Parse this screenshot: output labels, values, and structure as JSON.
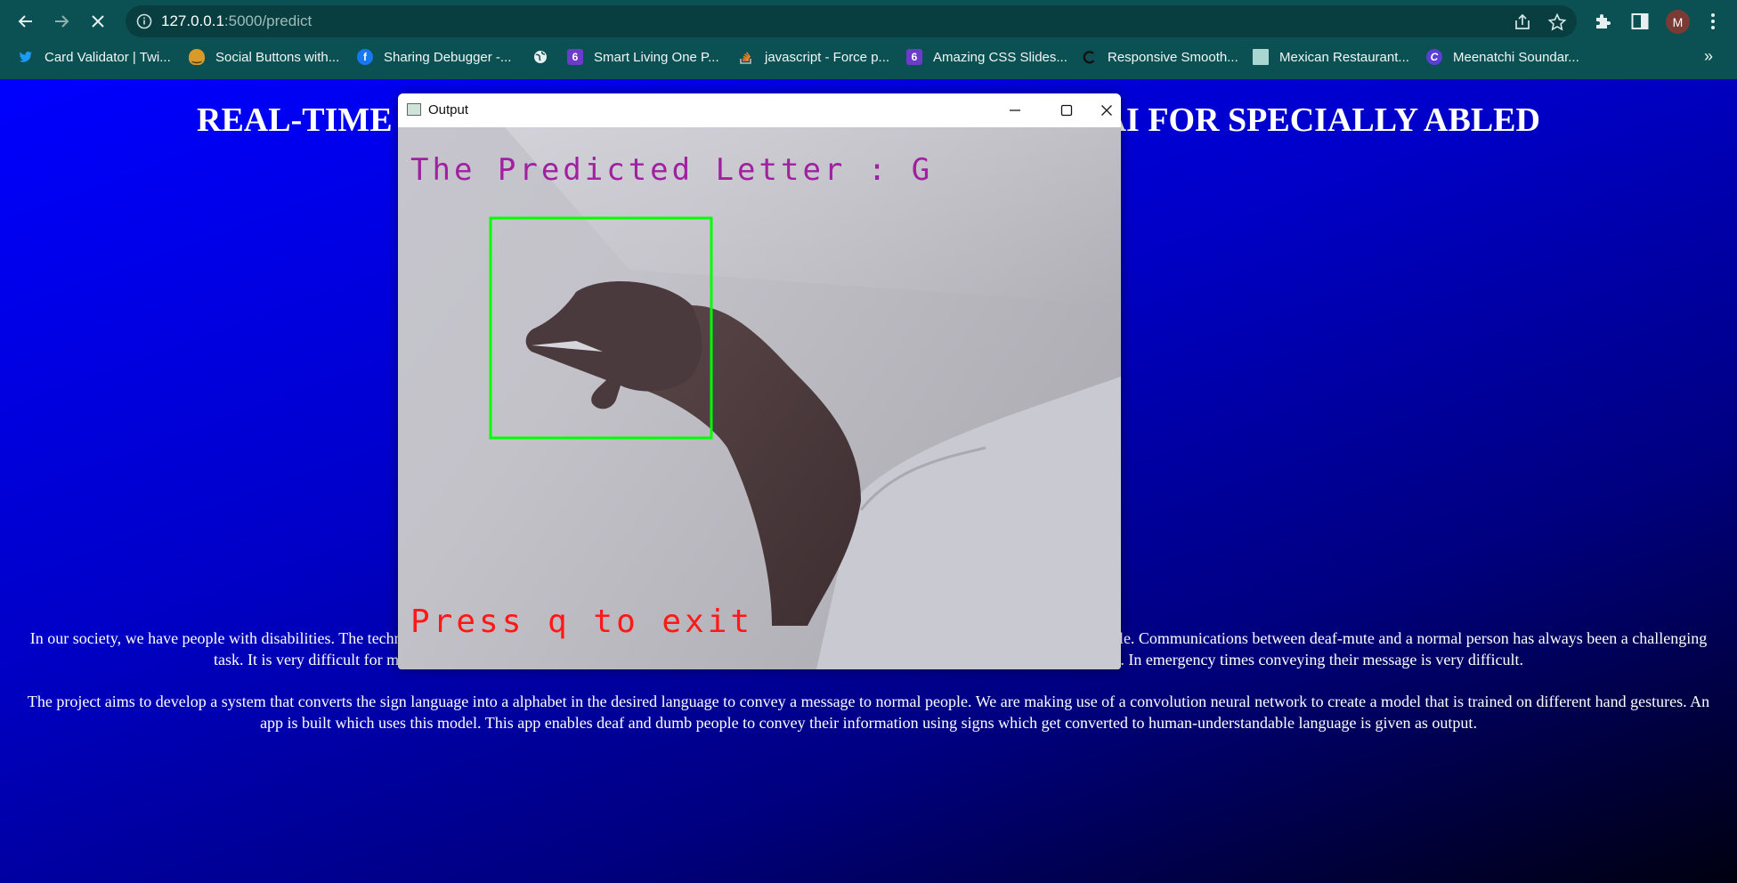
{
  "browser": {
    "url_host": "127.0.0.1",
    "url_path": ":5000/predict",
    "profile_initial": "M",
    "bookmarks": [
      {
        "label": "Card Validator | Twi...",
        "icon": "twitter-bird-icon",
        "color": "#1d9bf0"
      },
      {
        "label": "Social Buttons with...",
        "icon": "smiley-face-icon",
        "color": "#d99a2a"
      },
      {
        "label": "Sharing Debugger -...",
        "icon": "facebook-icon",
        "color": "#1877f2"
      },
      {
        "label": "",
        "icon": "globe-icon",
        "color": "#e6f0f0"
      },
      {
        "label": "Smart Living One P...",
        "icon": "number-six-icon",
        "color": "#6a3cc9"
      },
      {
        "label": "javascript - Force p...",
        "icon": "stack-overflow-icon",
        "color": "#f48024"
      },
      {
        "label": "Amazing CSS Slides...",
        "icon": "number-six-icon",
        "color": "#6a3cc9"
      },
      {
        "label": "Responsive Smooth...",
        "icon": "codepen-swirl-icon",
        "color": "#222222"
      },
      {
        "label": "Mexican Restaurant...",
        "icon": "image-placeholder-icon",
        "color": "#a9d6d0"
      },
      {
        "label": "Meenatchi Soundar...",
        "icon": "letter-c-icon",
        "color": "#5a3fd6"
      }
    ],
    "more_bookmarks": "»"
  },
  "page": {
    "title": "REAL-TIME COMMUNICATION SYSTEM POWERED BY AI FOR SPECIALLY ABLED",
    "paragraph1": "In our society, we have people with disabilities. The technology is developing day by day but no significant developments are undertaken for the betterment of these people. Communications between deaf-mute and a normal person has always been a challenging task. It is very difficult for mute people to convey their message to normal people. Since normal people are not trained on hand sign language. In emergency times conveying their message is very difficult.",
    "paragraph2": "The project aims to develop a system that converts the sign language into a alphabet in the desired language to convey a message to normal people. We are making use of a convolution neural network to create a model that is trained on different hand gestures. An app is built which uses this model. This app enables deaf and dumb people to convey their information using signs which get converted to human-understandable language is given as output."
  },
  "output_window": {
    "title": "Output",
    "predicted_text": "The Predicted Letter : G",
    "exit_text": "Press q to exit",
    "roi_color": "#00ff00"
  }
}
